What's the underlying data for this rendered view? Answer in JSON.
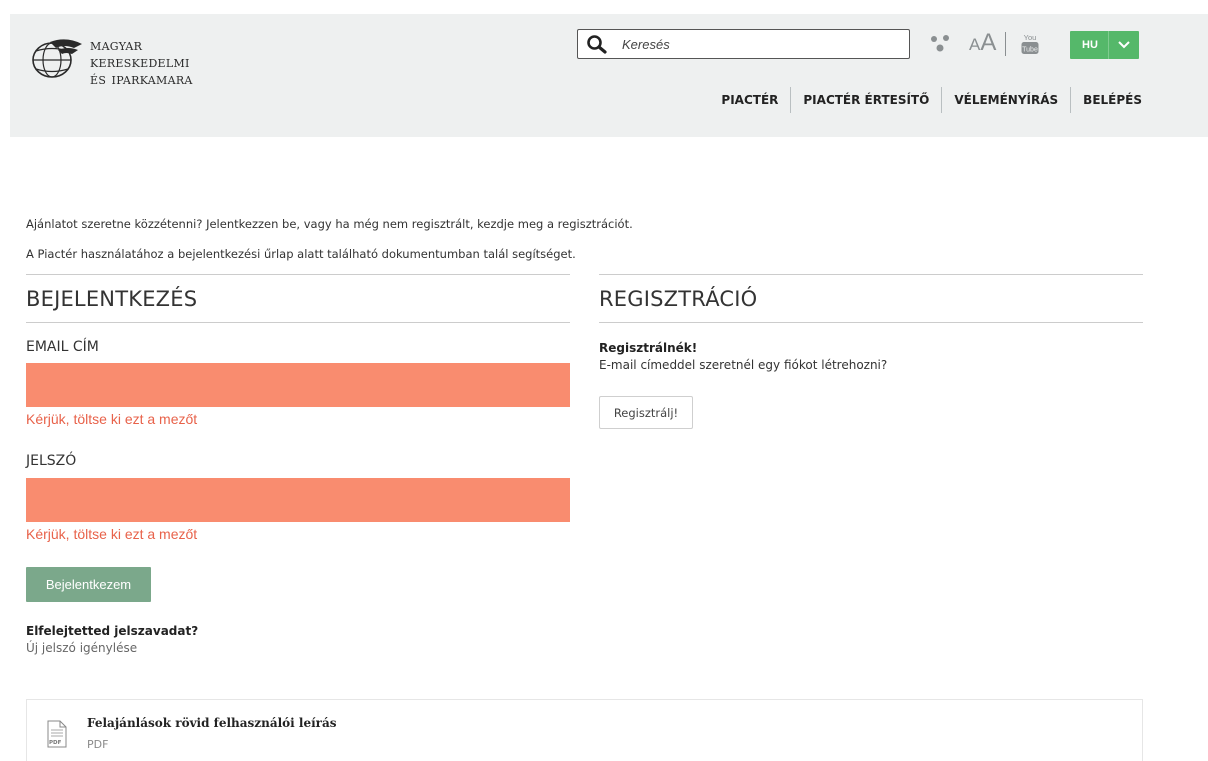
{
  "header": {
    "logo_lines": [
      "Magyar",
      "Kereskedelmi",
      "és Iparkamara"
    ],
    "search_placeholder": "Keresés",
    "font_size_small": "A",
    "font_size_big": "A",
    "youtube_top": "You",
    "youtube_bottom": "Tube",
    "language": "HU",
    "nav": [
      "PIACTÉR",
      "PIACTÉR ÉRTESÍTŐ",
      "VÉLEMÉNYÍRÁS",
      "BELÉPÉS"
    ],
    "colors": {
      "background": "#eef0f0",
      "language_button": "#55b86a"
    }
  },
  "intro": {
    "line1": "Ajánlatot szeretne közzétenni? Jelentkezzen be, vagy ha még nem regisztrált, kezdje meg a regisztrációt.",
    "line2": "A Piactér használatához a bejelentkezési űrlap alatt található dokumentumban talál segítséget."
  },
  "login": {
    "title": "BEJELENTKEZÉS",
    "email_label": "EMAIL CÍM",
    "email_value": "",
    "email_error": "Kérjük, töltse ki ezt a mezőt",
    "password_label": "JELSZÓ",
    "password_value": "",
    "password_error": "Kérjük, töltse ki ezt a mezőt",
    "submit_label": "Bejelentkezem",
    "forgot_title": "Elfelejtetted jelszavadat?",
    "forgot_link": "Új jelszó igénylése",
    "colors": {
      "error_field": "#f98c6f",
      "error_text": "#e8624a",
      "button": "#7ba88b"
    }
  },
  "register": {
    "title": "REGISZTRÁCIÓ",
    "heading": "Regisztrálnék!",
    "description": "E-mail címeddel szeretnél egy fiókot létrehozni?",
    "button_label": "Regisztrálj!"
  },
  "document": {
    "title": "Felajánlások rövid felhasználói leírás",
    "type": "PDF",
    "icon_text": "PDF"
  }
}
